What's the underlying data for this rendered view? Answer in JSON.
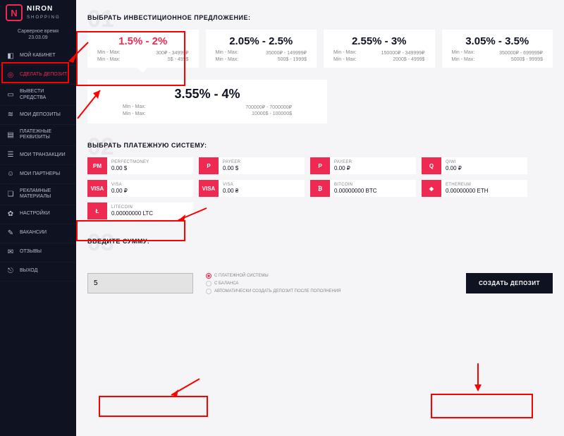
{
  "brand": {
    "name": "NIRON",
    "sub": "SHOPPING",
    "icon": "N"
  },
  "server_time": {
    "label": "Сарверное время",
    "value": "23.03.09"
  },
  "nav": [
    {
      "label": "МОЙ КАБИНЕТ",
      "icon": "◧"
    },
    {
      "label": "СДЕЛАТЬ ДЕПОЗИТ",
      "icon": "◎",
      "active": true
    },
    {
      "label": "ВЫВЕСТИ СРЕДСТВА",
      "icon": "▭"
    },
    {
      "label": "МОИ ДЕПОЗИТЫ",
      "icon": "≋"
    },
    {
      "label": "ПЛАТЕЖНЫЕ РЕКВИЗИТЫ",
      "icon": "▤"
    },
    {
      "label": "МОИ ТРАНЗАКЦИИ",
      "icon": "☰"
    },
    {
      "label": "МОИ ПАРТНЕРЫ",
      "icon": "☺"
    },
    {
      "label": "РЕКЛАМНЫЕ МАТЕРИАЛЫ",
      "icon": "❏"
    },
    {
      "label": "НАСТРОЙКИ",
      "icon": "✿"
    },
    {
      "label": "ВАКАНСИИ",
      "icon": "✎"
    },
    {
      "label": "ОТЗЫВЫ",
      "icon": "✉"
    },
    {
      "label": "ВЫХОД",
      "icon": "⎋"
    }
  ],
  "section1": {
    "num": "01",
    "title": "ВЫБРАТЬ ИНВЕСТИЦИОННОЕ ПРЕДЛОЖЕНИЕ:"
  },
  "plans": [
    {
      "rate": "1.5% - 2%",
      "mm1l": "Min - Max:",
      "mm1v": "300₽ - 34999₽",
      "mm2l": "Min - Max:",
      "mm2v": "5$ - 499$",
      "selected": true
    },
    {
      "rate": "2.05% - 2.5%",
      "mm1l": "Min - Max:",
      "mm1v": "35000₽ - 149999₽",
      "mm2l": "Min - Max:",
      "mm2v": "500$ - 1999$"
    },
    {
      "rate": "2.55% - 3%",
      "mm1l": "Min - Max:",
      "mm1v": "150000₽ - 349999₽",
      "mm2l": "Min - Max:",
      "mm2v": "2000$ - 4999$"
    },
    {
      "rate": "3.05% - 3.5%",
      "mm1l": "Min - Max:",
      "mm1v": "350000₽ - 699999₽",
      "mm2l": "Min - Max:",
      "mm2v": "5000$ - 9999$"
    }
  ],
  "plan_big": {
    "rate": "3.55% - 4%",
    "mm1l": "Min - Max:",
    "mm1v": "700000₽ - 7000000₽",
    "mm2l": "Min - Max:",
    "mm2v": "10000$ - 100000$"
  },
  "section2": {
    "num": "02",
    "title": "ВЫБРАТЬ ПЛАТЕЖНУЮ СИСТЕМУ:"
  },
  "payments": [
    {
      "icon": "PM",
      "name": "PERFECTMONEY",
      "bal": "0.00 $",
      "selected": true
    },
    {
      "icon": "P",
      "name": "PAYEER",
      "bal": "0.00 $"
    },
    {
      "icon": "P",
      "name": "PAYEER",
      "bal": "0.00 ₽"
    },
    {
      "icon": "Q",
      "name": "QIWI",
      "bal": "0.00 ₽"
    },
    {
      "icon": "VISA",
      "name": "VISA",
      "bal": "0.00 ₽"
    },
    {
      "icon": "VISA",
      "name": "VISA",
      "bal": "0.00 ₴"
    },
    {
      "icon": "₿",
      "name": "BITCOIN",
      "bal": "0.00000000 BTC"
    },
    {
      "icon": "◆",
      "name": "ETHEREUM",
      "bal": "0.00000000 ETH"
    },
    {
      "icon": "Ł",
      "name": "LITECOIN",
      "bal": "0.00000000 LTC"
    }
  ],
  "section3": {
    "num": "03",
    "title": "ВВЕДИТЕ СУММУ:"
  },
  "amount": {
    "value": "5"
  },
  "radios": [
    {
      "label": "С ПЛАТЕЖНОЙ СИСТЕМЫ",
      "on": true
    },
    {
      "label": "С БАЛАНСА",
      "on": false
    },
    {
      "label": "АВТОМАТИЧЕСКИ СОЗДАТЬ ДЕПОЗИТ ПОСЛЕ ПОПОЛНЕНИЯ",
      "on": false
    }
  ],
  "create_btn": "СОЗДАТЬ ДЕПОЗИТ"
}
